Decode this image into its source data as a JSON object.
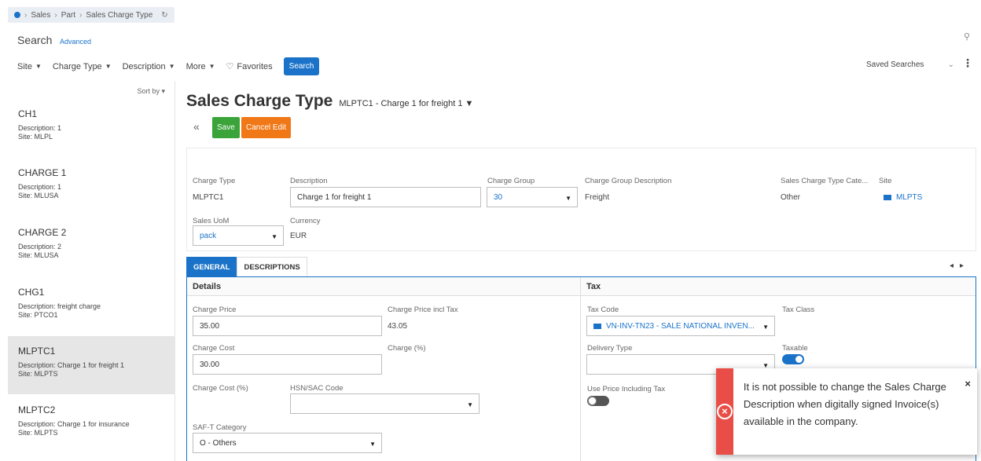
{
  "breadcrumb": [
    "Sales",
    "Part",
    "Sales Charge Type"
  ],
  "search": {
    "title": "Search",
    "advanced": "Advanced"
  },
  "filters": [
    "Site",
    "Charge Type",
    "Description",
    "More"
  ],
  "favorites_label": "Favorites",
  "search_button": "Search",
  "saved_searches": "Saved Searches",
  "sort_label": "Sort by",
  "list": [
    {
      "name": "CH1",
      "desc": "Description:  1",
      "site": "Site:  MLPL"
    },
    {
      "name": "CHARGE 1",
      "desc": "Description:  1",
      "site": "Site:  MLUSA"
    },
    {
      "name": "CHARGE 2",
      "desc": "Description:  2",
      "site": "Site:  MLUSA"
    },
    {
      "name": "CHG1",
      "desc": "Description:  freight charge",
      "site": "Site:  PTCO1"
    },
    {
      "name": "MLPTC1",
      "desc": "Description:  Charge 1 for freight 1",
      "site": "Site:  MLPTS"
    },
    {
      "name": "MLPTC2",
      "desc": "Description:  Charge 1 for insurance",
      "site": "Site:  MLPTS"
    }
  ],
  "page": {
    "title": "Sales Charge Type",
    "record": "MLPTC1 - Charge 1 for freight 1"
  },
  "actions": {
    "save": "Save",
    "cancel": "Cancel Edit"
  },
  "header": {
    "charge_type_label": "Charge Type",
    "charge_type": "MLPTC1",
    "description_label": "Description",
    "description": "Charge 1 for freight 1",
    "charge_group_label": "Charge Group",
    "charge_group": "30",
    "charge_group_desc_label": "Charge Group Description",
    "charge_group_desc": "Freight",
    "category_label": "Sales Charge Type Cate...",
    "category": "Other",
    "site_label": "Site",
    "site": "MLPTS",
    "uom_label": "Sales UoM",
    "uom": "pack",
    "currency_label": "Currency",
    "currency": "EUR"
  },
  "tabs": [
    "GENERAL",
    "DESCRIPTIONS"
  ],
  "details": {
    "heading": "Details",
    "charge_price_label": "Charge Price",
    "charge_price": "35.00",
    "price_incl_tax_label": "Charge Price incl Tax",
    "price_incl_tax": "43.05",
    "charge_cost_label": "Charge Cost",
    "charge_cost": "30.00",
    "charge_pct_label": "Charge (%)",
    "cost_pct_label": "Charge Cost (%)",
    "hsn_label": "HSN/SAC Code",
    "saft_label": "SAF-T Category",
    "saft": "O - Others"
  },
  "tax": {
    "heading": "Tax",
    "tax_code_label": "Tax Code",
    "tax_code": "VN-INV-TN23 - SALE NATIONAL INVEN...",
    "tax_class_label": "Tax Class",
    "delivery_label": "Delivery Type",
    "taxable_label": "Taxable",
    "taxable": true,
    "use_price_label": "Use Price Including Tax",
    "use_price": false
  },
  "toast": {
    "message": "It is not possible to change the Sales Charge Description when digitally signed Invoice(s) available in the company."
  },
  "colors": {
    "accent": "#1a73c9",
    "save": "#3aa33a",
    "cancel": "#f07817",
    "error": "#e84e47"
  }
}
